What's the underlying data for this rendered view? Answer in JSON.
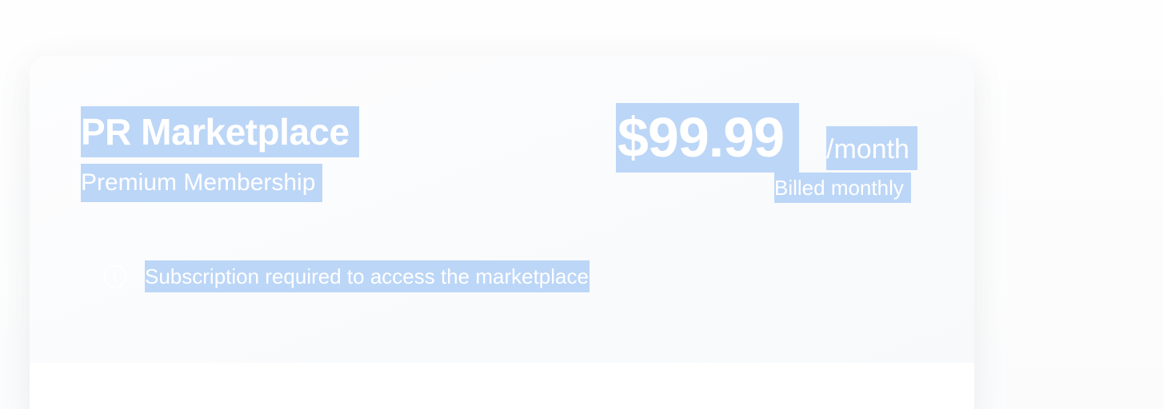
{
  "plan": {
    "title": "PR Marketplace",
    "subtitle": "Premium Membership"
  },
  "pricing": {
    "amount": "$99.99",
    "period": "/month",
    "billing_note": "Billed monthly"
  },
  "notice": {
    "icon": "info-icon",
    "text": "Subscription required to access the marketplace"
  },
  "colors": {
    "selection_highlight": "#bcd6f7",
    "text": "#ffffff",
    "card_background": "#ffffff",
    "header_background": "#f7f9fb"
  }
}
